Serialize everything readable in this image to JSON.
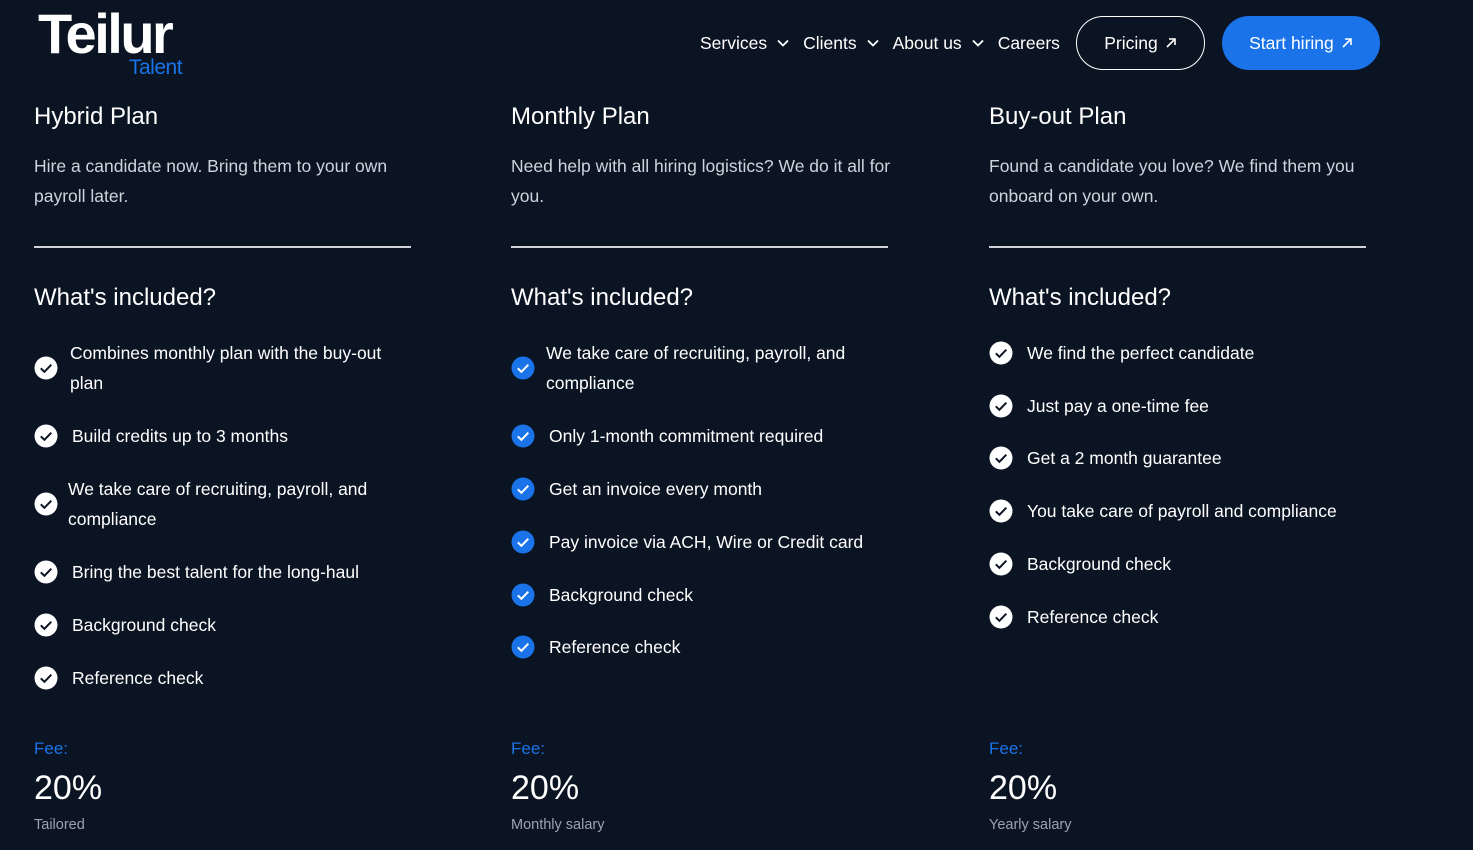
{
  "brand": {
    "name": "Teilur",
    "sub": "Talent",
    "accent": "#1a73e8",
    "background": "#0b1423"
  },
  "nav": {
    "items": [
      {
        "label": "Services",
        "icon": "chevron-down-icon"
      },
      {
        "label": "Clients",
        "icon": "chevron-down-icon"
      },
      {
        "label": "About us",
        "icon": "chevron-down-icon"
      },
      {
        "label": "Careers"
      }
    ],
    "pricing_label": "Pricing",
    "start_label": "Start hiring"
  },
  "plans": [
    {
      "title": "Hybrid Plan",
      "description": "Hire a candidate now. Bring them to your own payroll later.",
      "included_heading": "What's included?",
      "check_style": "white",
      "features": [
        "Combines monthly plan with the buy-out plan",
        "Build credits up to 3 months",
        "We take care of recruiting, payroll, and compliance",
        "Bring the best talent for the long-haul",
        "Background check",
        "Reference check"
      ],
      "fee_label": "Fee:",
      "fee_value": "20%",
      "fee_note": "Tailored"
    },
    {
      "title": "Monthly Plan",
      "description": "Need help with all hiring logistics? We do it all for you.",
      "included_heading": "What's included?",
      "check_style": "blue",
      "features": [
        "We take care of recruiting, payroll, and compliance",
        "Only 1-month commitment required",
        "Get an invoice every month",
        "Pay invoice via ACH, Wire or Credit card",
        "Background check",
        "Reference check"
      ],
      "fee_label": "Fee:",
      "fee_value": "20%",
      "fee_note": "Monthly salary"
    },
    {
      "title": "Buy-out Plan",
      "description": "Found a candidate you love? We find them you onboard on your own.",
      "included_heading": "What's included?",
      "check_style": "white",
      "features": [
        "We find the perfect candidate",
        "Just pay a one-time fee",
        "Get a 2 month guarantee",
        "You take care of payroll and compliance",
        "Background check",
        "Reference check"
      ],
      "fee_label": "Fee:",
      "fee_value": "20%",
      "fee_note": "Yearly salary"
    }
  ]
}
